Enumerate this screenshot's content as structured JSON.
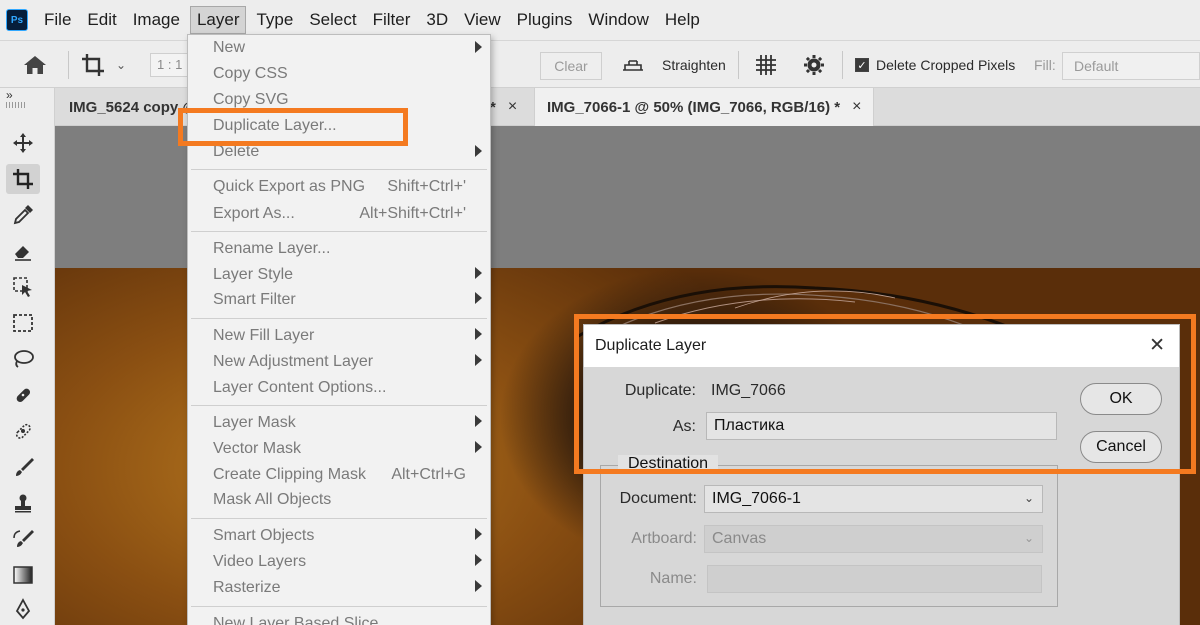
{
  "menubar": {
    "logo": "Ps",
    "items": [
      "File",
      "Edit",
      "Image",
      "Layer",
      "Type",
      "Select",
      "Filter",
      "3D",
      "View",
      "Plugins",
      "Window",
      "Help"
    ]
  },
  "options_bar": {
    "ratio": "1 : 1",
    "clear_label": "Clear",
    "straighten_label": "Straighten",
    "delete_cropped_label": "Delete Cropped Pixels",
    "fill_label": "Fill:",
    "fill_value": "Default"
  },
  "tabs": [
    {
      "label": "IMG_5624 copy @",
      "close": ""
    },
    {
      "label": "*",
      "close": "×"
    },
    {
      "label": "IMG_7066-1 @ 50% (IMG_7066, RGB/16) *",
      "close": "×"
    }
  ],
  "toolbar": {
    "collapse": "»"
  },
  "layer_menu": {
    "items": {
      "new": "New",
      "copy_css": "Copy CSS",
      "copy_svg": "Copy SVG",
      "duplicate_layer": "Duplicate Layer...",
      "delete": "Delete",
      "quick_export": "Quick Export as PNG",
      "quick_export_shortcut": "Shift+Ctrl+'",
      "export_as": "Export As...",
      "export_as_shortcut": "Alt+Shift+Ctrl+'",
      "rename_layer": "Rename Layer...",
      "layer_style": "Layer Style",
      "smart_filter": "Smart Filter",
      "new_fill_layer": "New Fill Layer",
      "new_adjustment_layer": "New Adjustment Layer",
      "layer_content_options": "Layer Content Options...",
      "layer_mask": "Layer Mask",
      "vector_mask": "Vector Mask",
      "create_clipping_mask": "Create Clipping Mask",
      "create_clipping_mask_shortcut": "Alt+Ctrl+G",
      "mask_all_objects": "Mask All Objects",
      "smart_objects": "Smart Objects",
      "video_layers": "Video Layers",
      "rasterize": "Rasterize",
      "new_layer_based_slice": "New Layer Based Slice"
    }
  },
  "dialog": {
    "title": "Duplicate Layer",
    "close": "✕",
    "duplicate_label": "Duplicate:",
    "duplicate_value": "IMG_7066",
    "as_label": "As:",
    "as_value": "Пластика",
    "ok_label": "OK",
    "cancel_label": "Cancel",
    "destination_label": "Destination",
    "document_label": "Document:",
    "document_value": "IMG_7066-1",
    "artboard_label": "Artboard:",
    "artboard_value": "Canvas",
    "name_label": "Name:",
    "name_value": ""
  },
  "colors": {
    "highlight": "#f47a20",
    "ps_logo_bg": "#061e3a",
    "ps_logo_fg": "#31a8ff"
  }
}
